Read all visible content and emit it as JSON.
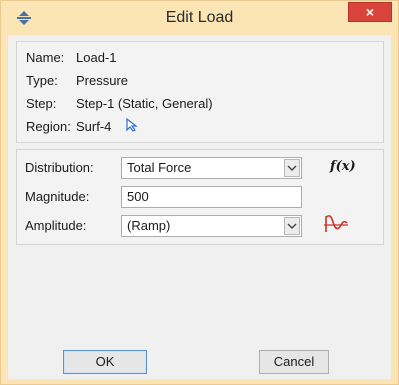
{
  "window": {
    "title": "Edit Load",
    "close_symbol": "×",
    "icons": {
      "app": "move-arrows-icon",
      "close": "close-icon"
    }
  },
  "info": {
    "name": {
      "label": "Name:",
      "value": "Load-1"
    },
    "type": {
      "label": "Type:",
      "value": "Pressure"
    },
    "step": {
      "label": "Step:",
      "value": "Step-1 (Static, General)"
    },
    "region": {
      "label": "Region:",
      "value": "Surf-4",
      "icon": "pick-cursor-icon"
    }
  },
  "params": {
    "distribution": {
      "label": "Distribution:",
      "value": "Total Force",
      "fx_label": "f(x)"
    },
    "magnitude": {
      "label": "Magnitude:",
      "value": "500"
    },
    "amplitude": {
      "label": "Amplitude:",
      "value": "(Ramp)",
      "icon": "amplitude-curve-icon"
    }
  },
  "buttons": {
    "ok": "OK",
    "cancel": "Cancel"
  },
  "colors": {
    "titlebar": "#fbe5b5",
    "close": "#d9443a",
    "accent": "#2a6fd6"
  }
}
